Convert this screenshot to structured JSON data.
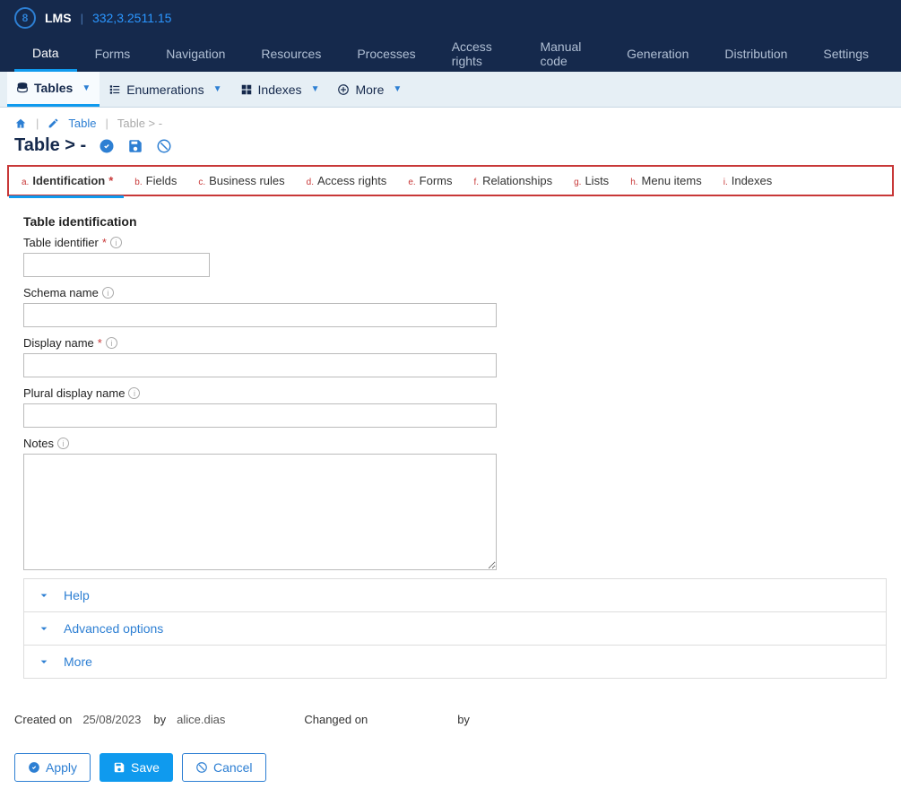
{
  "header": {
    "app_name": "LMS",
    "version": "332,3.2511.15"
  },
  "main_nav": [
    {
      "label": "Data",
      "active": true
    },
    {
      "label": "Forms"
    },
    {
      "label": "Navigation"
    },
    {
      "label": "Resources"
    },
    {
      "label": "Processes"
    },
    {
      "label": "Access rights"
    },
    {
      "label": "Manual code"
    },
    {
      "label": "Generation"
    },
    {
      "label": "Distribution"
    },
    {
      "label": "Settings"
    }
  ],
  "sub_nav": {
    "tables": "Tables",
    "enumerations": "Enumerations",
    "indexes": "Indexes",
    "more": "More"
  },
  "breadcrumb": {
    "link_text": "Table",
    "current": "Table > -"
  },
  "page_title": "Table > -",
  "section_tabs": [
    {
      "letter": "a.",
      "label": "Identification",
      "active": true,
      "required": true
    },
    {
      "letter": "b.",
      "label": "Fields"
    },
    {
      "letter": "c.",
      "label": "Business rules"
    },
    {
      "letter": "d.",
      "label": "Access rights"
    },
    {
      "letter": "e.",
      "label": "Forms"
    },
    {
      "letter": "f.",
      "label": "Relationships"
    },
    {
      "letter": "g.",
      "label": "Lists"
    },
    {
      "letter": "h.",
      "label": "Menu items"
    },
    {
      "letter": "i.",
      "label": "Indexes"
    }
  ],
  "form": {
    "section_heading": "Table identification",
    "table_identifier_label": "Table identifier",
    "table_identifier_value": "",
    "schema_name_label": "Schema name",
    "schema_name_value": "",
    "display_name_label": "Display name",
    "display_name_value": "",
    "plural_display_name_label": "Plural display name",
    "plural_display_name_value": "",
    "notes_label": "Notes",
    "notes_value": ""
  },
  "collapsibles": {
    "help": "Help",
    "advanced": "Advanced options",
    "more": "More"
  },
  "meta": {
    "created_on_label": "Created on",
    "created_on_value": "25/08/2023",
    "created_by_label": "by",
    "created_by_value": "alice.dias",
    "changed_on_label": "Changed on",
    "changed_on_value": "",
    "changed_by_label": "by",
    "changed_by_value": ""
  },
  "buttons": {
    "apply": "Apply",
    "save": "Save",
    "cancel": "Cancel"
  }
}
